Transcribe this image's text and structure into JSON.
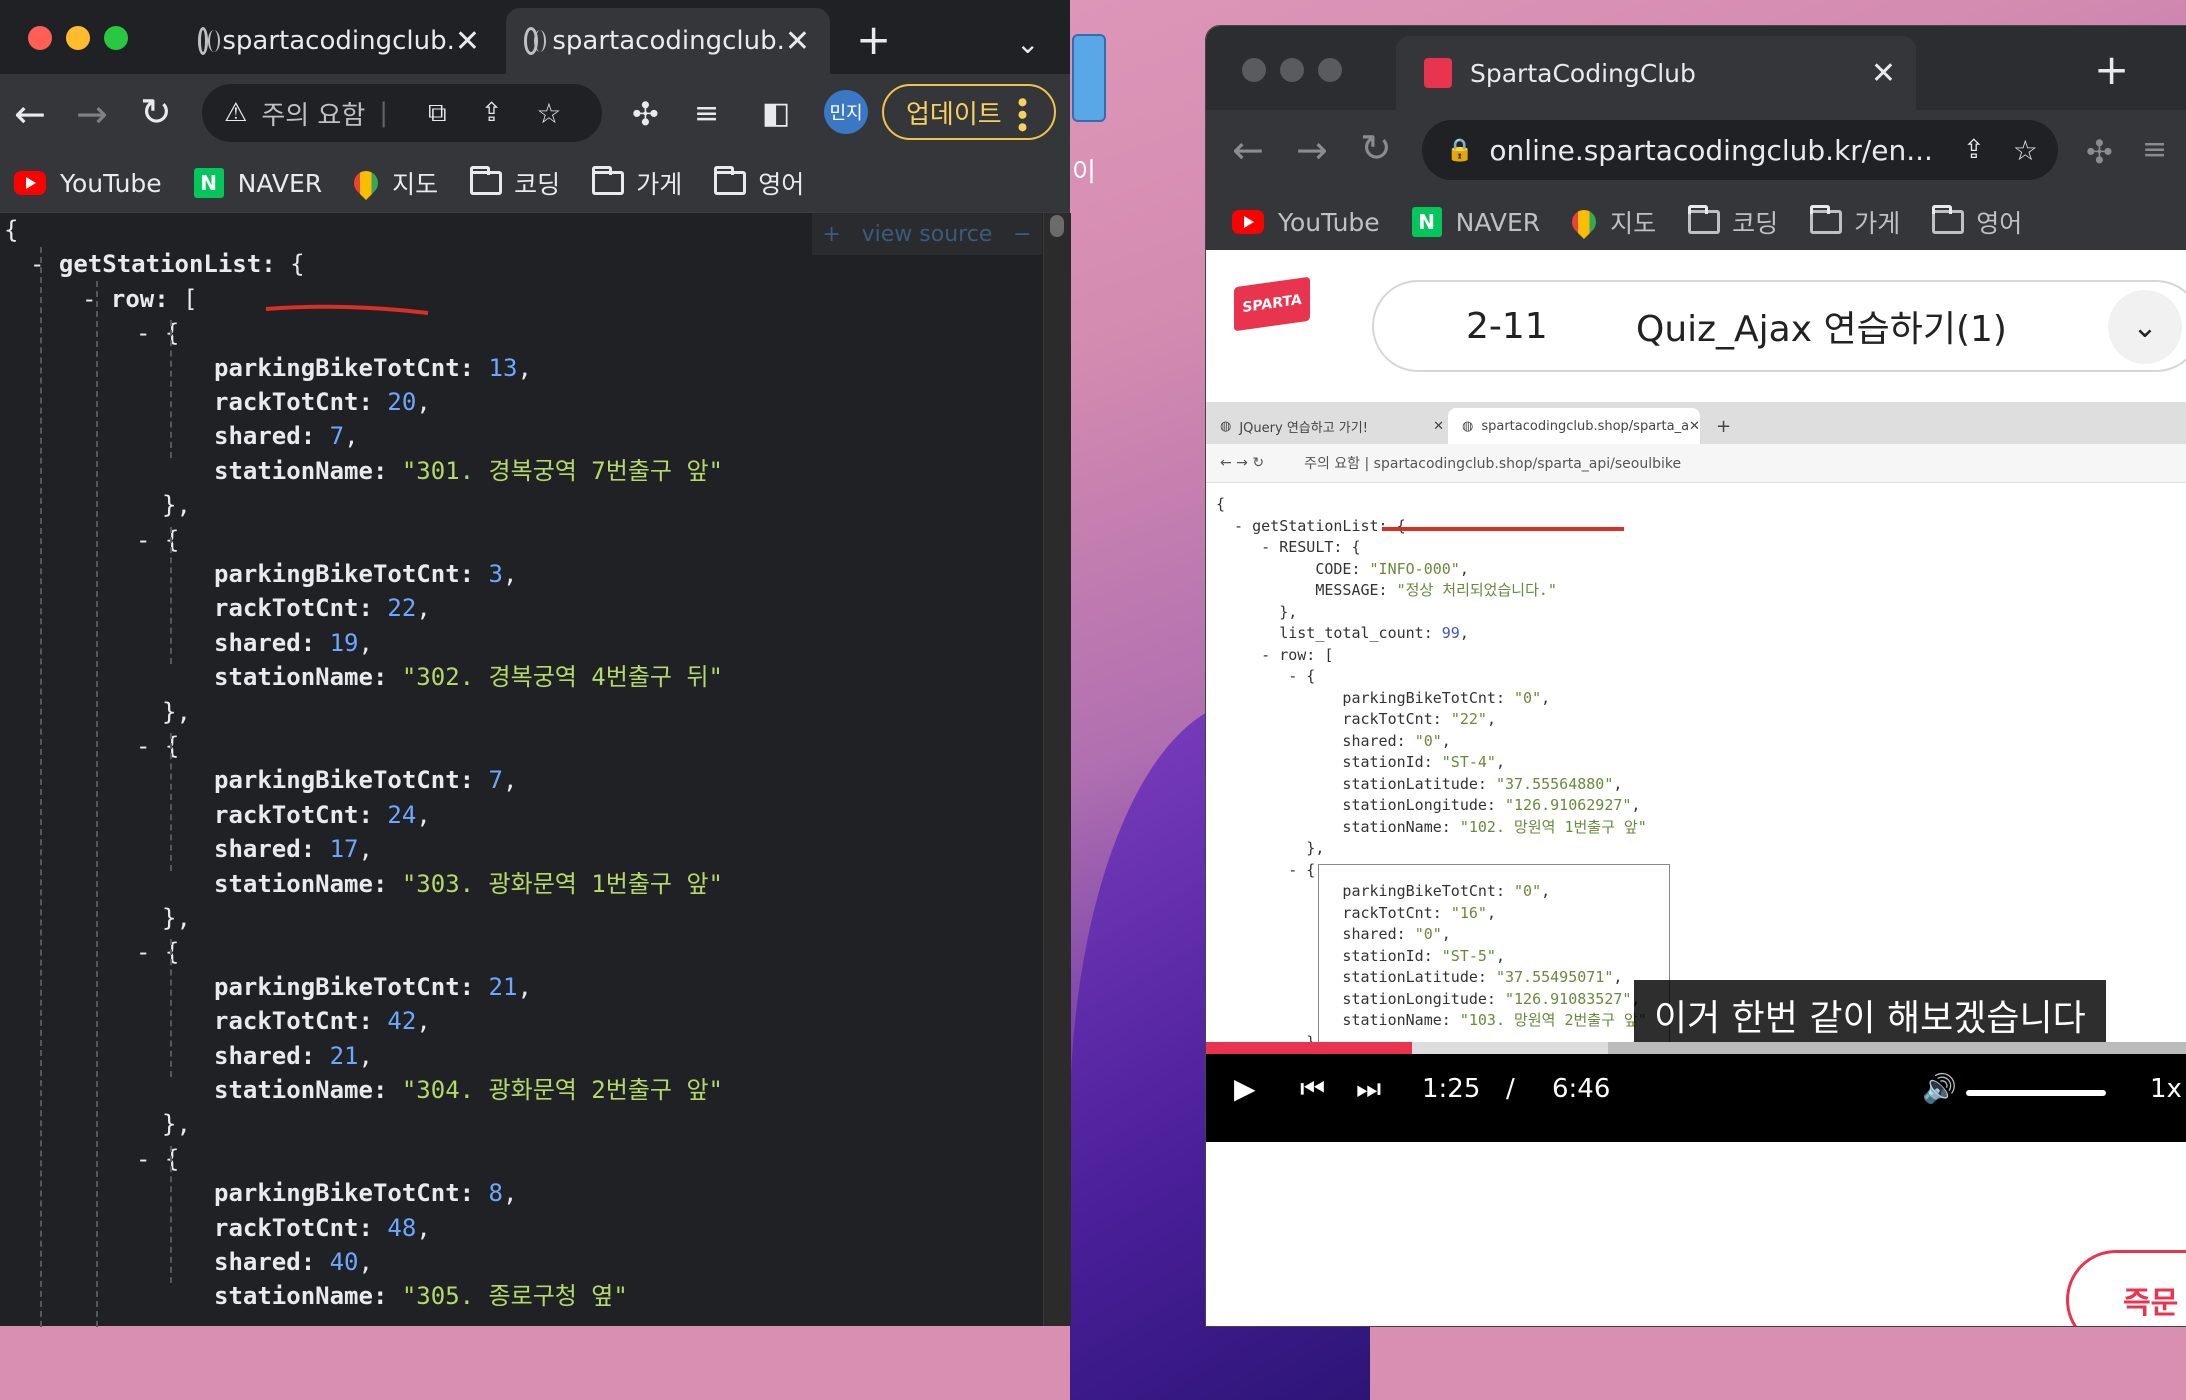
{
  "left_window": {
    "tabs": [
      {
        "title": "spartacodingclub.",
        "active": false
      },
      {
        "title": "spartacodingclub.",
        "active": true
      }
    ],
    "address": {
      "warning_label": "주의 요함"
    },
    "profile": "민지",
    "update_button": "업데이트",
    "bookmarks": [
      {
        "icon": "youtube-icon",
        "label": "YouTube"
      },
      {
        "icon": "naver-icon",
        "label": "NAVER"
      },
      {
        "icon": "maps-icon",
        "label": "지도"
      },
      {
        "icon": "folder-icon",
        "label": "코딩"
      },
      {
        "icon": "folder-icon",
        "label": "가게"
      },
      {
        "icon": "folder-icon",
        "label": "영어"
      }
    ],
    "view_source": {
      "plus": "+",
      "label": "view source",
      "minus": "−"
    },
    "json": {
      "open_brace": "{",
      "root_key": "getStationList",
      "row_key": "row",
      "rows": [
        {
          "parkingBikeTotCnt": 13,
          "rackTotCnt": 20,
          "shared": 7,
          "stationName": "\"301. 경복궁역 7번출구 앞\""
        },
        {
          "parkingBikeTotCnt": 3,
          "rackTotCnt": 22,
          "shared": 19,
          "stationName": "\"302. 경복궁역 4번출구 뒤\""
        },
        {
          "parkingBikeTotCnt": 7,
          "rackTotCnt": 24,
          "shared": 17,
          "stationName": "\"303. 광화문역 1번출구 앞\""
        },
        {
          "parkingBikeTotCnt": 21,
          "rackTotCnt": 42,
          "shared": 21,
          "stationName": "\"304. 광화문역 2번출구 앞\""
        },
        {
          "parkingBikeTotCnt": 8,
          "rackTotCnt": 48,
          "shared": 40,
          "stationName": "\"305. 종로구청 옆\""
        }
      ]
    }
  },
  "desktop": {
    "label": "이"
  },
  "right_window": {
    "tab_title": "SpartaCodingClub",
    "address": "online.spartacodingclub.kr/en...",
    "bookmarks": [
      {
        "icon": "youtube-icon",
        "label": "YouTube"
      },
      {
        "icon": "naver-icon",
        "label": "NAVER"
      },
      {
        "icon": "maps-icon",
        "label": "지도"
      },
      {
        "icon": "folder-icon",
        "label": "코딩"
      },
      {
        "icon": "folder-icon",
        "label": "가게"
      },
      {
        "icon": "folder-icon",
        "label": "영어"
      }
    ],
    "logo": "SPARTA",
    "lesson": {
      "number": "2-11",
      "title": "Quiz_Ajax 연습하기(1)"
    },
    "video": {
      "tabs": [
        "JQuery 연습하고 가기!",
        "spartacodingclub.shop/sparta_a"
      ],
      "address": "주의 요함 | spartacodingclub.shop/sparta_api/seoulbike",
      "json_lines": [
        "{",
        "  - getStationList: {",
        "     - RESULT: {",
        "           CODE: \"INFO-000\",",
        "           MESSAGE: \"정상 처리되었습니다.\"",
        "       },",
        "       list_total_count: 99,",
        "     - row: [",
        "        - {",
        "              parkingBikeTotCnt: \"0\",",
        "              rackTotCnt: \"22\",",
        "              shared: \"0\",",
        "              stationId: \"ST-4\",",
        "              stationLatitude: \"37.55564880\",",
        "              stationLongitude: \"126.91062927\",",
        "              stationName: \"102. 망원역 1번출구 앞\"",
        "          },",
        "        - {",
        "              parkingBikeTotCnt: \"0\",",
        "              rackTotCnt: \"16\",",
        "              shared: \"0\",",
        "              stationId: \"ST-5\",",
        "              stationLatitude: \"37.55495071\",",
        "              stationLongitude: \"126.91083527\",",
        "              stationName: \"103. 망원역 2번출구 앞\"",
        "          },",
        "        - {"
      ],
      "caption": "이거 한번 같이 해보겠습니다",
      "current_time": "1:25",
      "separator": "/",
      "duration": "6:46",
      "progress": 0.21,
      "buffered": 0.41,
      "volume": 1.0,
      "speed": "1x"
    },
    "cta_label": "즉문"
  }
}
